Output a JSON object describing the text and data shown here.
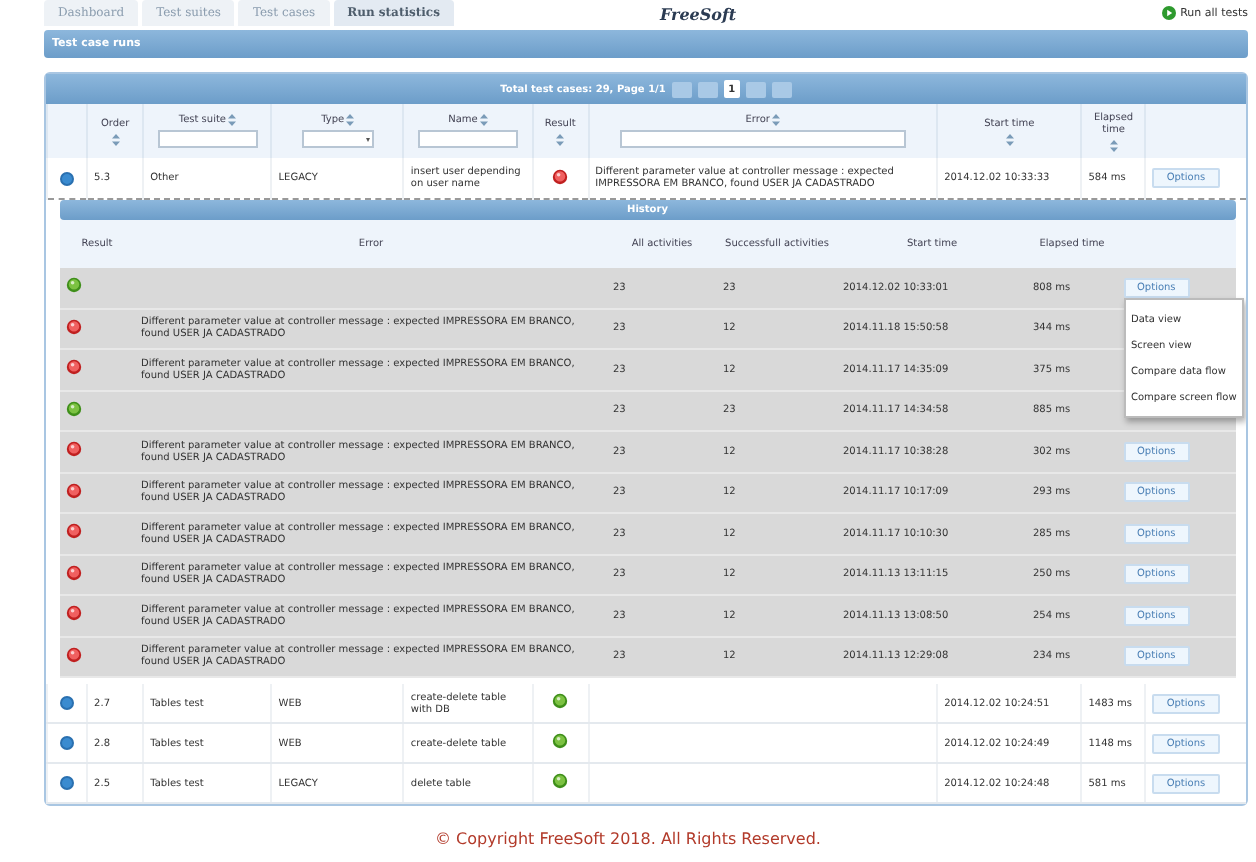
{
  "tabs": [
    {
      "label": "Dashboard",
      "selected": false
    },
    {
      "label": "Test suites",
      "selected": false
    },
    {
      "label": "Test cases",
      "selected": false
    },
    {
      "label": "Run statistics",
      "selected": true
    }
  ],
  "logo": "FreeSoft",
  "run_all": "Run all tests",
  "section_title": "Test case runs",
  "pager": {
    "summary": "Total test cases: 29, Page 1/1",
    "page": "1"
  },
  "columns": [
    {
      "label": "Order",
      "kind": "plain"
    },
    {
      "label": "Test suite",
      "kind": "text"
    },
    {
      "label": "Type",
      "kind": "select"
    },
    {
      "label": "Name",
      "kind": "text"
    },
    {
      "label": "Result",
      "kind": "plain"
    },
    {
      "label": "Error",
      "kind": "text"
    },
    {
      "label": "Start time",
      "kind": "plain"
    },
    {
      "label": "Elapsed time",
      "kind": "plain"
    }
  ],
  "rows_before": [
    {
      "order": "5.3",
      "suite": "Other",
      "type": "LEGACY",
      "name": "insert user depending on user name",
      "passed": false,
      "error": "Different parameter value at controller message : expected IMPRESSORA EM BRANCO, found USER JA CADASTRADO",
      "start": "2014.12.02 10:33:33",
      "elapsed": "584 ms",
      "options": "Options"
    }
  ],
  "history": {
    "title": "History",
    "columns": [
      "Result",
      "Error",
      "All activities",
      "Successfull activities",
      "Start time",
      "Elapsed time"
    ],
    "rows": [
      {
        "passed": true,
        "all": "23",
        "successful": "23",
        "start": "2014.12.02 10:33:01",
        "elapsed": "808 ms",
        "options": "Options",
        "menu": [
          "Data view",
          "Screen view",
          "Compare data flow",
          "Compare screen flow"
        ]
      },
      {
        "passed": false,
        "error": "Different parameter value at controller message : expected IMPRESSORA EM BRANCO, found USER JA CADASTRADO",
        "all": "23",
        "successful": "12",
        "start": "2014.11.18 15:50:58",
        "elapsed": "344 ms"
      },
      {
        "passed": false,
        "error": "Different parameter value at controller message : expected IMPRESSORA EM BRANCO, found USER JA CADASTRADO",
        "all": "23",
        "successful": "12",
        "start": "2014.11.17 14:35:09",
        "elapsed": "375 ms"
      },
      {
        "passed": true,
        "all": "23",
        "successful": "23",
        "start": "2014.11.17 14:34:58",
        "elapsed": "885 ms"
      },
      {
        "passed": false,
        "error": "Different parameter value at controller message : expected IMPRESSORA EM BRANCO, found USER JA CADASTRADO",
        "all": "23",
        "successful": "12",
        "start": "2014.11.17 10:38:28",
        "elapsed": "302 ms",
        "options": "Options"
      },
      {
        "passed": false,
        "error": "Different parameter value at controller message : expected IMPRESSORA EM BRANCO, found USER JA CADASTRADO",
        "all": "23",
        "successful": "12",
        "start": "2014.11.17 10:17:09",
        "elapsed": "293 ms",
        "options": "Options"
      },
      {
        "passed": false,
        "error": "Different parameter value at controller message : expected IMPRESSORA EM BRANCO, found USER JA CADASTRADO",
        "all": "23",
        "successful": "12",
        "start": "2014.11.17 10:10:30",
        "elapsed": "285 ms",
        "options": "Options"
      },
      {
        "passed": false,
        "error": "Different parameter value at controller message : expected IMPRESSORA EM BRANCO, found USER JA CADASTRADO",
        "all": "23",
        "successful": "12",
        "start": "2014.11.13 13:11:15",
        "elapsed": "250 ms",
        "options": "Options"
      },
      {
        "passed": false,
        "error": "Different parameter value at controller message : expected IMPRESSORA EM BRANCO, found USER JA CADASTRADO",
        "all": "23",
        "successful": "12",
        "start": "2014.11.13 13:08:50",
        "elapsed": "254 ms",
        "options": "Options"
      },
      {
        "passed": false,
        "error": "Different parameter value at controller message : expected IMPRESSORA EM BRANCO, found USER JA CADASTRADO",
        "all": "23",
        "successful": "12",
        "start": "2014.11.13 12:29:08",
        "elapsed": "234 ms",
        "options": "Options"
      }
    ]
  },
  "rows_after": [
    {
      "order": "2.7",
      "suite": "Tables test",
      "type": "WEB",
      "name": "create-delete table with DB",
      "passed": true,
      "start": "2014.12.02 10:24:51",
      "elapsed": "1483 ms",
      "options": "Options"
    },
    {
      "order": "2.8",
      "suite": "Tables test",
      "type": "WEB",
      "name": "create-delete table",
      "passed": true,
      "start": "2014.12.02 10:24:49",
      "elapsed": "1148 ms",
      "options": "Options"
    },
    {
      "order": "2.5",
      "suite": "Tables test",
      "type": "LEGACY",
      "name": "delete table",
      "passed": true,
      "start": "2014.12.02 10:24:48",
      "elapsed": "581 ms",
      "options": "Options"
    }
  ],
  "footer": "© Copyright FreeSoft 2018. All Rights Reserved."
}
